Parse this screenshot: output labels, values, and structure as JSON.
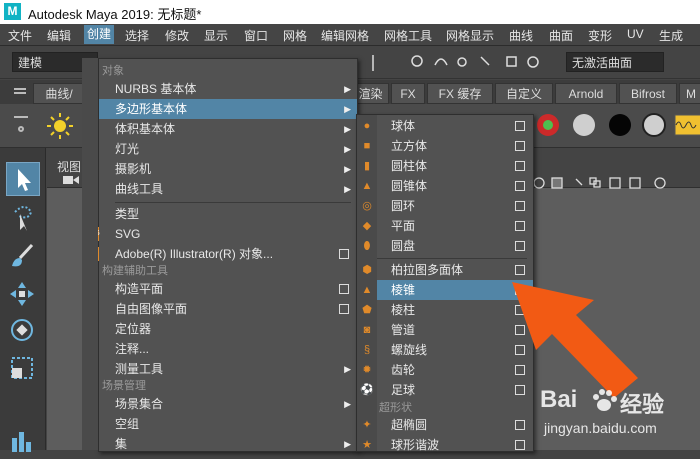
{
  "window": {
    "logo": "M",
    "title": "Autodesk Maya 2019: 无标题*"
  },
  "menubar": [
    "文件",
    "编辑",
    "创建",
    "选择",
    "修改",
    "显示",
    "窗口",
    "网格",
    "编辑网格",
    "网格工具",
    "网格显示",
    "曲线",
    "曲面",
    "变形",
    "UV",
    "生成"
  ],
  "menubar_active": "创建",
  "toolbar": {
    "mode": "建模",
    "construction": "无激活曲面"
  },
  "shelf": {
    "curve_tab": "曲线/",
    "tabs": [
      "渲染",
      "FX",
      "FX 缓存",
      "自定义",
      "Arnold",
      "Bifrost",
      "M"
    ]
  },
  "viewport": {
    "label": "视图"
  },
  "create_menu": {
    "sections": {
      "objects": "对象",
      "construct": "构建辅助工具",
      "scene": "场景管理"
    },
    "items": [
      {
        "label": "NURBS 基本体",
        "submenu": true
      },
      {
        "label": "多边形基本体",
        "submenu": true,
        "highlighted": true
      },
      {
        "label": "体积基本体",
        "submenu": true
      },
      {
        "label": "灯光",
        "submenu": true
      },
      {
        "label": "摄影机",
        "submenu": true
      },
      {
        "label": "曲线工具",
        "submenu": true
      },
      {
        "label": "类型"
      },
      {
        "label": "SVG"
      },
      {
        "label": "Adobe(R) Illustrator(R) 对象...",
        "option": true
      },
      {
        "label": "构造平面",
        "option": true
      },
      {
        "label": "自由图像平面",
        "option": true
      },
      {
        "label": "定位器"
      },
      {
        "label": "注释..."
      },
      {
        "label": "测量工具",
        "submenu": true
      },
      {
        "label": "场景集合",
        "submenu": true
      },
      {
        "label": "空组"
      },
      {
        "label": "集",
        "submenu": true
      }
    ]
  },
  "poly_menu": {
    "section_super": "超形状",
    "items": [
      {
        "label": "球体"
      },
      {
        "label": "立方体"
      },
      {
        "label": "圆柱体"
      },
      {
        "label": "圆锥体"
      },
      {
        "label": "圆环"
      },
      {
        "label": "平面"
      },
      {
        "label": "圆盘"
      },
      {
        "label": "柏拉图多面体"
      },
      {
        "label": "棱锥",
        "highlighted": true
      },
      {
        "label": "棱柱"
      },
      {
        "label": "管道"
      },
      {
        "label": "螺旋线"
      },
      {
        "label": "齿轮"
      },
      {
        "label": "足球"
      },
      {
        "label": "超椭圆"
      },
      {
        "label": "球形谐波"
      }
    ]
  },
  "watermark": {
    "brand": "Bai",
    "brand2": "经验",
    "site": "jingyan.baidu.com"
  },
  "colors": {
    "accent": "#5285a6",
    "arrow": "#f25a14",
    "menu_bg": "#525252"
  }
}
